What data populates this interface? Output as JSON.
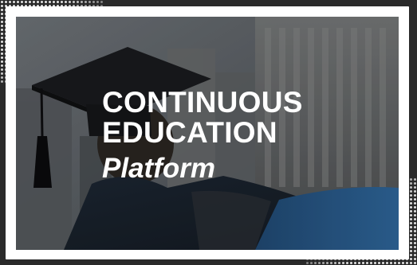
{
  "banner": {
    "line1": "CONTINUOUS",
    "line2": "EDUCATION",
    "line3": "Platform"
  },
  "colors": {
    "frame": "#ffffff",
    "background": "#2a2a2a",
    "text": "#ffffff",
    "gown_blue": "#2b5d8e"
  },
  "icons": [
    "graduation-cap-icon",
    "tassel-icon"
  ]
}
